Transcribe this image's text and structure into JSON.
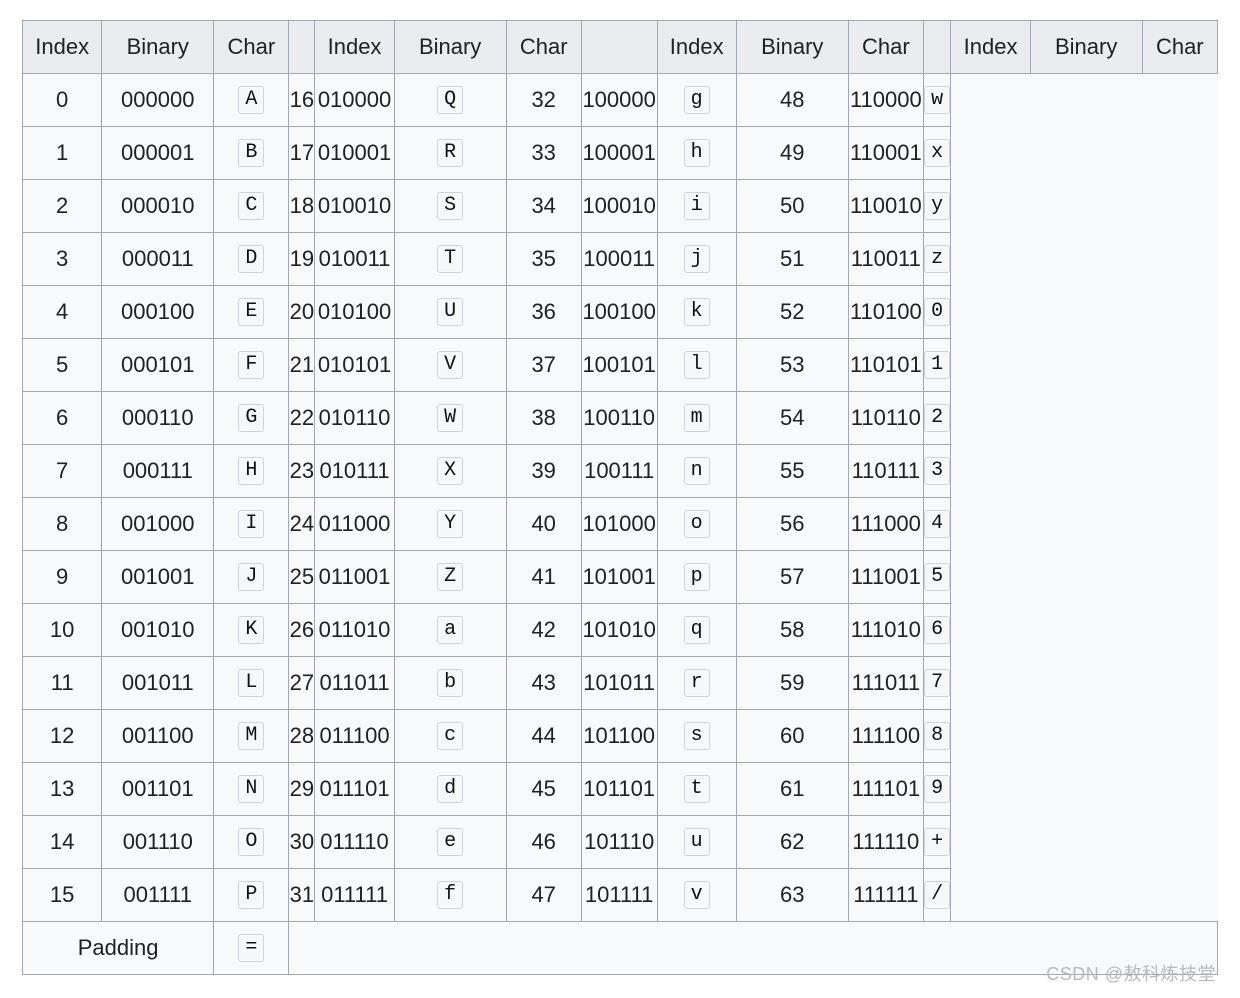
{
  "headers": {
    "index": "Index",
    "binary": "Binary",
    "char": "Char"
  },
  "padding": {
    "label": "Padding",
    "char": "="
  },
  "watermark": "CSDN @敖科炼技堂",
  "groups": [
    [
      {
        "index": "0",
        "binary": "000000",
        "char": "A"
      },
      {
        "index": "1",
        "binary": "000001",
        "char": "B"
      },
      {
        "index": "2",
        "binary": "000010",
        "char": "C"
      },
      {
        "index": "3",
        "binary": "000011",
        "char": "D"
      },
      {
        "index": "4",
        "binary": "000100",
        "char": "E"
      },
      {
        "index": "5",
        "binary": "000101",
        "char": "F"
      },
      {
        "index": "6",
        "binary": "000110",
        "char": "G"
      },
      {
        "index": "7",
        "binary": "000111",
        "char": "H"
      },
      {
        "index": "8",
        "binary": "001000",
        "char": "I"
      },
      {
        "index": "9",
        "binary": "001001",
        "char": "J"
      },
      {
        "index": "10",
        "binary": "001010",
        "char": "K"
      },
      {
        "index": "11",
        "binary": "001011",
        "char": "L"
      },
      {
        "index": "12",
        "binary": "001100",
        "char": "M"
      },
      {
        "index": "13",
        "binary": "001101",
        "char": "N"
      },
      {
        "index": "14",
        "binary": "001110",
        "char": "O"
      },
      {
        "index": "15",
        "binary": "001111",
        "char": "P"
      }
    ],
    [
      {
        "index": "16",
        "binary": "010000",
        "char": "Q"
      },
      {
        "index": "17",
        "binary": "010001",
        "char": "R"
      },
      {
        "index": "18",
        "binary": "010010",
        "char": "S"
      },
      {
        "index": "19",
        "binary": "010011",
        "char": "T"
      },
      {
        "index": "20",
        "binary": "010100",
        "char": "U"
      },
      {
        "index": "21",
        "binary": "010101",
        "char": "V"
      },
      {
        "index": "22",
        "binary": "010110",
        "char": "W"
      },
      {
        "index": "23",
        "binary": "010111",
        "char": "X"
      },
      {
        "index": "24",
        "binary": "011000",
        "char": "Y"
      },
      {
        "index": "25",
        "binary": "011001",
        "char": "Z"
      },
      {
        "index": "26",
        "binary": "011010",
        "char": "a"
      },
      {
        "index": "27",
        "binary": "011011",
        "char": "b"
      },
      {
        "index": "28",
        "binary": "011100",
        "char": "c"
      },
      {
        "index": "29",
        "binary": "011101",
        "char": "d"
      },
      {
        "index": "30",
        "binary": "011110",
        "char": "e"
      },
      {
        "index": "31",
        "binary": "011111",
        "char": "f"
      }
    ],
    [
      {
        "index": "32",
        "binary": "100000",
        "char": "g"
      },
      {
        "index": "33",
        "binary": "100001",
        "char": "h"
      },
      {
        "index": "34",
        "binary": "100010",
        "char": "i"
      },
      {
        "index": "35",
        "binary": "100011",
        "char": "j"
      },
      {
        "index": "36",
        "binary": "100100",
        "char": "k"
      },
      {
        "index": "37",
        "binary": "100101",
        "char": "l"
      },
      {
        "index": "38",
        "binary": "100110",
        "char": "m"
      },
      {
        "index": "39",
        "binary": "100111",
        "char": "n"
      },
      {
        "index": "40",
        "binary": "101000",
        "char": "o"
      },
      {
        "index": "41",
        "binary": "101001",
        "char": "p"
      },
      {
        "index": "42",
        "binary": "101010",
        "char": "q"
      },
      {
        "index": "43",
        "binary": "101011",
        "char": "r"
      },
      {
        "index": "44",
        "binary": "101100",
        "char": "s"
      },
      {
        "index": "45",
        "binary": "101101",
        "char": "t"
      },
      {
        "index": "46",
        "binary": "101110",
        "char": "u"
      },
      {
        "index": "47",
        "binary": "101111",
        "char": "v"
      }
    ],
    [
      {
        "index": "48",
        "binary": "110000",
        "char": "w"
      },
      {
        "index": "49",
        "binary": "110001",
        "char": "x"
      },
      {
        "index": "50",
        "binary": "110010",
        "char": "y"
      },
      {
        "index": "51",
        "binary": "110011",
        "char": "z"
      },
      {
        "index": "52",
        "binary": "110100",
        "char": "0"
      },
      {
        "index": "53",
        "binary": "110101",
        "char": "1"
      },
      {
        "index": "54",
        "binary": "110110",
        "char": "2"
      },
      {
        "index": "55",
        "binary": "110111",
        "char": "3"
      },
      {
        "index": "56",
        "binary": "111000",
        "char": "4"
      },
      {
        "index": "57",
        "binary": "111001",
        "char": "5"
      },
      {
        "index": "58",
        "binary": "111010",
        "char": "6"
      },
      {
        "index": "59",
        "binary": "111011",
        "char": "7"
      },
      {
        "index": "60",
        "binary": "111100",
        "char": "8"
      },
      {
        "index": "61",
        "binary": "111101",
        "char": "9"
      },
      {
        "index": "62",
        "binary": "111110",
        "char": "+"
      },
      {
        "index": "63",
        "binary": "111111",
        "char": "/"
      }
    ]
  ]
}
